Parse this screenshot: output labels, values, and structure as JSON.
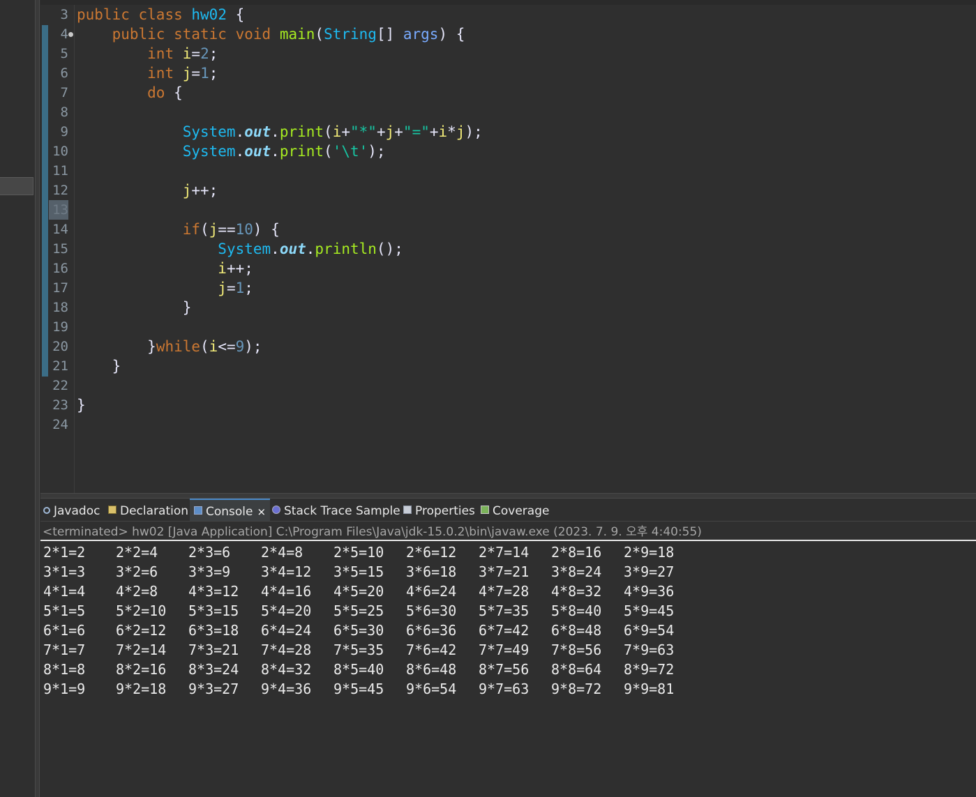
{
  "editor": {
    "lines": [
      {
        "num": "3",
        "tokens": [
          [
            "kw",
            "public"
          ],
          [
            "plain",
            " "
          ],
          [
            "kw",
            "class"
          ],
          [
            "plain",
            " "
          ],
          [
            "cls",
            "hw02"
          ],
          [
            "plain",
            " {"
          ]
        ]
      },
      {
        "num": "4",
        "fold": true,
        "tokens": [
          [
            "plain",
            "    "
          ],
          [
            "kw",
            "public"
          ],
          [
            "plain",
            " "
          ],
          [
            "kw",
            "static"
          ],
          [
            "plain",
            " "
          ],
          [
            "kw",
            "void"
          ],
          [
            "plain",
            " "
          ],
          [
            "fn",
            "main"
          ],
          [
            "plain",
            "("
          ],
          [
            "ty",
            "String"
          ],
          [
            "plain",
            "[] "
          ],
          [
            "par",
            "args"
          ],
          [
            "plain",
            ") {"
          ]
        ]
      },
      {
        "num": "5",
        "tokens": [
          [
            "plain",
            "        "
          ],
          [
            "kw",
            "int"
          ],
          [
            "plain",
            " "
          ],
          [
            "var",
            "i"
          ],
          [
            "plain",
            "="
          ],
          [
            "num",
            "2"
          ],
          [
            "plain",
            ";"
          ]
        ]
      },
      {
        "num": "6",
        "tokens": [
          [
            "plain",
            "        "
          ],
          [
            "kw",
            "int"
          ],
          [
            "plain",
            " "
          ],
          [
            "var",
            "j"
          ],
          [
            "plain",
            "="
          ],
          [
            "num",
            "1"
          ],
          [
            "plain",
            ";"
          ]
        ]
      },
      {
        "num": "7",
        "tokens": [
          [
            "plain",
            "        "
          ],
          [
            "kw",
            "do"
          ],
          [
            "plain",
            " {"
          ]
        ]
      },
      {
        "num": "8",
        "tokens": []
      },
      {
        "num": "9",
        "tokens": [
          [
            "plain",
            "            "
          ],
          [
            "cls",
            "System"
          ],
          [
            "plain",
            "."
          ],
          [
            "fld",
            "out"
          ],
          [
            "plain",
            "."
          ],
          [
            "fn",
            "print"
          ],
          [
            "plain",
            "("
          ],
          [
            "var",
            "i"
          ],
          [
            "plain",
            "+"
          ],
          [
            "str",
            "\"*\""
          ],
          [
            "plain",
            "+"
          ],
          [
            "var",
            "j"
          ],
          [
            "plain",
            "+"
          ],
          [
            "str",
            "\"=\""
          ],
          [
            "plain",
            "+"
          ],
          [
            "var",
            "i"
          ],
          [
            "plain",
            "*"
          ],
          [
            "var",
            "j"
          ],
          [
            "plain",
            ");"
          ]
        ]
      },
      {
        "num": "10",
        "tokens": [
          [
            "plain",
            "            "
          ],
          [
            "cls",
            "System"
          ],
          [
            "plain",
            "."
          ],
          [
            "fld",
            "out"
          ],
          [
            "plain",
            "."
          ],
          [
            "fn",
            "print"
          ],
          [
            "plain",
            "("
          ],
          [
            "str",
            "'\\t'"
          ],
          [
            "plain",
            ");"
          ]
        ]
      },
      {
        "num": "11",
        "tokens": []
      },
      {
        "num": "12",
        "tokens": [
          [
            "plain",
            "            "
          ],
          [
            "var",
            "j"
          ],
          [
            "plain",
            "++;"
          ]
        ]
      },
      {
        "num": "13",
        "highlight": true,
        "tokens": []
      },
      {
        "num": "14",
        "tokens": [
          [
            "plain",
            "            "
          ],
          [
            "kw",
            "if"
          ],
          [
            "plain",
            "("
          ],
          [
            "var",
            "j"
          ],
          [
            "plain",
            "=="
          ],
          [
            "num",
            "10"
          ],
          [
            "plain",
            ") {"
          ]
        ]
      },
      {
        "num": "15",
        "tokens": [
          [
            "plain",
            "                "
          ],
          [
            "cls",
            "System"
          ],
          [
            "plain",
            "."
          ],
          [
            "fld",
            "out"
          ],
          [
            "plain",
            "."
          ],
          [
            "fn",
            "println"
          ],
          [
            "plain",
            "();"
          ]
        ]
      },
      {
        "num": "16",
        "tokens": [
          [
            "plain",
            "                "
          ],
          [
            "var",
            "i"
          ],
          [
            "plain",
            "++;"
          ]
        ]
      },
      {
        "num": "17",
        "tokens": [
          [
            "plain",
            "                "
          ],
          [
            "var",
            "j"
          ],
          [
            "plain",
            "="
          ],
          [
            "num",
            "1"
          ],
          [
            "plain",
            ";"
          ]
        ]
      },
      {
        "num": "18",
        "tokens": [
          [
            "plain",
            "            }"
          ]
        ]
      },
      {
        "num": "19",
        "tokens": []
      },
      {
        "num": "20",
        "tokens": [
          [
            "plain",
            "        }"
          ],
          [
            "kw",
            "while"
          ],
          [
            "plain",
            "("
          ],
          [
            "var",
            "i"
          ],
          [
            "plain",
            "<="
          ],
          [
            "num",
            "9"
          ],
          [
            "plain",
            ");"
          ]
        ]
      },
      {
        "num": "21",
        "tokens": [
          [
            "plain",
            "    }"
          ]
        ]
      },
      {
        "num": "22",
        "tokens": []
      },
      {
        "num": "23",
        "tokens": [
          [
            "plain",
            "}"
          ]
        ]
      },
      {
        "num": "24",
        "tokens": []
      }
    ]
  },
  "panel": {
    "tabs": [
      {
        "label": "Javadoc",
        "icon": "javadoc-icon"
      },
      {
        "label": "Declaration",
        "icon": "declaration-icon"
      },
      {
        "label": "Console",
        "icon": "console-icon",
        "active": true,
        "close": "×"
      },
      {
        "label": "Stack Trace Sample",
        "icon": "stack-trace-icon"
      },
      {
        "label": "Properties",
        "icon": "properties-icon"
      },
      {
        "label": "Coverage",
        "icon": "coverage-icon"
      }
    ],
    "console_header": "<terminated> hw02 [Java Application] C:\\Program Files\\Java\\jdk-15.0.2\\bin\\javaw.exe  (2023. 7. 9. 오후 4:40:55)",
    "output": [
      [
        "2*1=2",
        "2*2=4",
        "2*3=6",
        "2*4=8",
        "2*5=10",
        "2*6=12",
        "2*7=14",
        "2*8=16",
        "2*9=18"
      ],
      [
        "3*1=3",
        "3*2=6",
        "3*3=9",
        "3*4=12",
        "3*5=15",
        "3*6=18",
        "3*7=21",
        "3*8=24",
        "3*9=27"
      ],
      [
        "4*1=4",
        "4*2=8",
        "4*3=12",
        "4*4=16",
        "4*5=20",
        "4*6=24",
        "4*7=28",
        "4*8=32",
        "4*9=36"
      ],
      [
        "5*1=5",
        "5*2=10",
        "5*3=15",
        "5*4=20",
        "5*5=25",
        "5*6=30",
        "5*7=35",
        "5*8=40",
        "5*9=45"
      ],
      [
        "6*1=6",
        "6*2=12",
        "6*3=18",
        "6*4=24",
        "6*5=30",
        "6*6=36",
        "6*7=42",
        "6*8=48",
        "6*9=54"
      ],
      [
        "7*1=7",
        "7*2=14",
        "7*3=21",
        "7*4=28",
        "7*5=35",
        "7*6=42",
        "7*7=49",
        "7*8=56",
        "7*9=63"
      ],
      [
        "8*1=8",
        "8*2=16",
        "8*3=24",
        "8*4=32",
        "8*5=40",
        "8*6=48",
        "8*7=56",
        "8*8=64",
        "8*9=72"
      ],
      [
        "9*1=9",
        "9*2=18",
        "9*3=27",
        "9*4=36",
        "9*5=45",
        "9*6=54",
        "9*7=63",
        "9*8=72",
        "9*9=81"
      ]
    ]
  },
  "colors": {
    "background": "#2f2f2f",
    "keyword": "#cc7832",
    "type": "#1ebaf1",
    "method": "#a7ec21",
    "variable": "#f3ec79",
    "number": "#6897bb",
    "string": "#17c6a3",
    "active_tab_accent": "#4a89c8"
  }
}
